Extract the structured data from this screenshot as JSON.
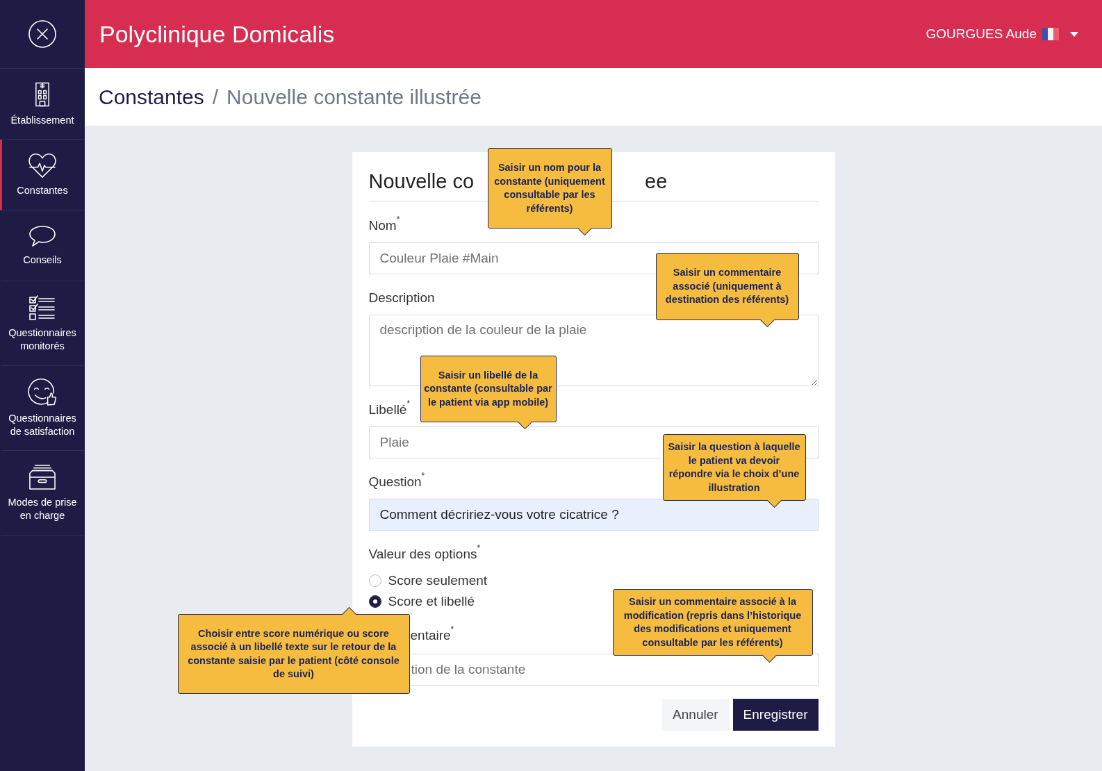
{
  "header": {
    "title": "Polyclinique Domicalis",
    "user": "GOURGUES Aude"
  },
  "sidebar": {
    "items": [
      {
        "label": "Établissement",
        "selected": false
      },
      {
        "label": "Constantes",
        "selected": true
      },
      {
        "label": "Conseils",
        "selected": false
      },
      {
        "label": "Questionnaires monitorés",
        "selected": false
      },
      {
        "label": "Questionnaires de satisfaction",
        "selected": false
      },
      {
        "label": "Modes de prise en charge",
        "selected": false
      }
    ]
  },
  "breadcrumb": {
    "items": [
      "Constantes",
      "Nouvelle constante illustrée"
    ],
    "separator": "/"
  },
  "form": {
    "heading_start": "Nouvelle co",
    "heading_end": "ee",
    "fields": [
      {
        "kind": "input",
        "label": "Nom$^{*}$",
        "placeholder": "Couleur Plaie #Main"
      },
      {
        "kind": "textarea",
        "label": "Description",
        "placeholder": "description de la couleur de la plaie"
      },
      {
        "kind": "input",
        "label": "Libellé$^{*}$",
        "placeholder": "Plaie"
      },
      {
        "kind": "input",
        "label": "Question$^{*}$",
        "value": "Comment décririez-vous votre cicatrice ?",
        "highlighted": true
      }
    ],
    "options": {
      "label": "Valeur des options$^{*}$",
      "choices": [
        {
          "label": "Score seulement",
          "selected": false
        },
        {
          "label": "Score et libellé",
          "selected": true
        }
      ]
    },
    "comment": {
      "label": "entaire$^{*}$",
      "placeholder": "tion de la constante"
    },
    "buttons": [
      {
        "label": "Annuler",
        "kind": "secondary"
      },
      {
        "label": "Enregistrer",
        "kind": "primary"
      }
    ]
  },
  "callouts": [
    {
      "text": "Saisir un nom pour la constante (uniquement consultable par les référents)"
    },
    {
      "text": "Saisir un commentaire associé (uniquement à destination des référents)"
    },
    {
      "text": "Saisir un libellé de la constante (consultable par le patient via app mobile)"
    },
    {
      "text": "Saisir la question à laquelle le patient va devoir répondre via le choix d’une illustration"
    },
    {
      "text": "Saisir un commentaire associé à la modification (repris dans l’historique des modifications et uniquement consultable par les référents)"
    },
    {
      "text": "Choisir entre score numérique ou score associé à un libellé texte sur le retour de la constante saisie par le patient (côté console de suivi)"
    }
  ]
}
